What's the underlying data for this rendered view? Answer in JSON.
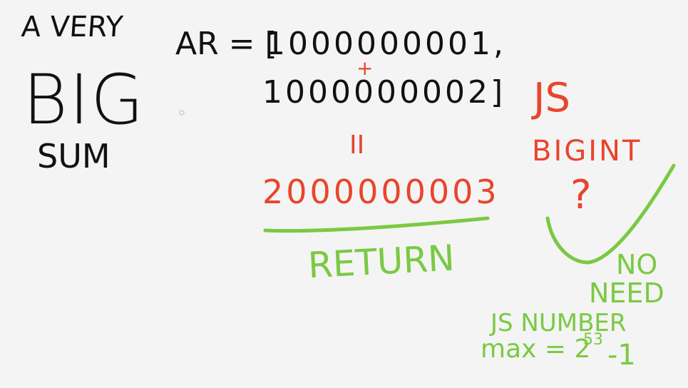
{
  "colors": {
    "ink_black": "#111111",
    "ink_red": "#e8452c",
    "ink_green": "#7ac943",
    "background": "#f4f4f4"
  },
  "title": {
    "line1": "A VERY",
    "line2": "BIG",
    "line3": "SUM"
  },
  "array": {
    "prefix": "AR = [",
    "value1": "1000000001,",
    "plus": "+",
    "value2": "1000000002]"
  },
  "result": {
    "equals": "II",
    "value": "2000000003"
  },
  "return_label": "RETURN",
  "bigint_note": {
    "line1": "JS",
    "line2": "BIGINT",
    "line3": "?"
  },
  "no_need": {
    "line1": "NO",
    "line2": "NEED"
  },
  "number_note": {
    "line1": "JS NUMBER",
    "max_prefix": "max = 2",
    "exponent": "53",
    "suffix": "-1"
  }
}
